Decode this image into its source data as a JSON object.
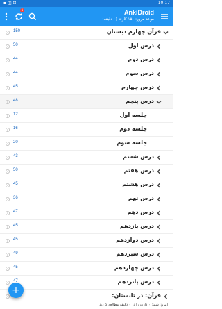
{
  "status_bar": {
    "time": "10:17",
    "icons": "▪ ◫ ⊡"
  },
  "app_bar": {
    "title": "AnkiDroid",
    "subtitle": "موعد مرور: ۱۵۰ کارت (۰ دقیقه)",
    "sync_badge": "1",
    "icons": {
      "overflow": "more-vertical-icon",
      "sync": "sync-icon",
      "search": "search-icon",
      "drawer": "hamburger-menu-icon"
    }
  },
  "decks": [
    {
      "name": "قرآن چهارم دبستان",
      "count": "150",
      "level": 0,
      "chevron": "down",
      "selected": false
    },
    {
      "name": "درس اول",
      "count": "50",
      "level": 1,
      "chevron": "right",
      "selected": false
    },
    {
      "name": "درس دوم",
      "count": "44",
      "level": 1,
      "chevron": "right",
      "selected": false
    },
    {
      "name": "درس سوم",
      "count": "44",
      "level": 1,
      "chevron": "right",
      "selected": false
    },
    {
      "name": "درس چهارم",
      "count": "45",
      "level": 1,
      "chevron": "right",
      "selected": false
    },
    {
      "name": "درس پنجم",
      "count": "48",
      "level": 1,
      "chevron": "down",
      "selected": true
    },
    {
      "name": "جلسه اول",
      "count": "12",
      "level": 2,
      "chevron": "",
      "selected": false
    },
    {
      "name": "جلسه دوم",
      "count": "16",
      "level": 2,
      "chevron": "",
      "selected": false
    },
    {
      "name": "جلسه سوم",
      "count": "20",
      "level": 2,
      "chevron": "",
      "selected": false
    },
    {
      "name": "درس ششم",
      "count": "43",
      "level": 1,
      "chevron": "right",
      "selected": false
    },
    {
      "name": "درس هفتم",
      "count": "50",
      "level": 1,
      "chevron": "right",
      "selected": false
    },
    {
      "name": "درس هشتم",
      "count": "45",
      "level": 1,
      "chevron": "right",
      "selected": false
    },
    {
      "name": "درس نهم",
      "count": "36",
      "level": 1,
      "chevron": "right",
      "selected": false
    },
    {
      "name": "درس دهم",
      "count": "47",
      "level": 1,
      "chevron": "right",
      "selected": false
    },
    {
      "name": "درس یازدهم",
      "count": "45",
      "level": 1,
      "chevron": "right",
      "selected": false
    },
    {
      "name": "درس دوازدهم",
      "count": "45",
      "level": 1,
      "chevron": "right",
      "selected": false
    },
    {
      "name": "درس سیزدهم",
      "count": "49",
      "level": 1,
      "chevron": "right",
      "selected": false
    },
    {
      "name": "درس چهاردهم",
      "count": "45",
      "level": 1,
      "chevron": "right",
      "selected": false
    },
    {
      "name": "درس پانزدهم",
      "count": "47",
      "level": 1,
      "chevron": "right",
      "selected": false
    },
    {
      "name": "قرآن: در تابستان:",
      "count": "",
      "level": 0,
      "chevron": "right",
      "selected": false
    }
  ],
  "footer": {
    "status_text": "امروز شما: ۰ کارت را در ۰ دقیقه مطالعه کردید"
  },
  "fab": {
    "label": "+"
  },
  "colors": {
    "primary": "#2196f3",
    "primary_dark": "#1976d2",
    "count": "#1565c0",
    "accent": "#f44336"
  }
}
